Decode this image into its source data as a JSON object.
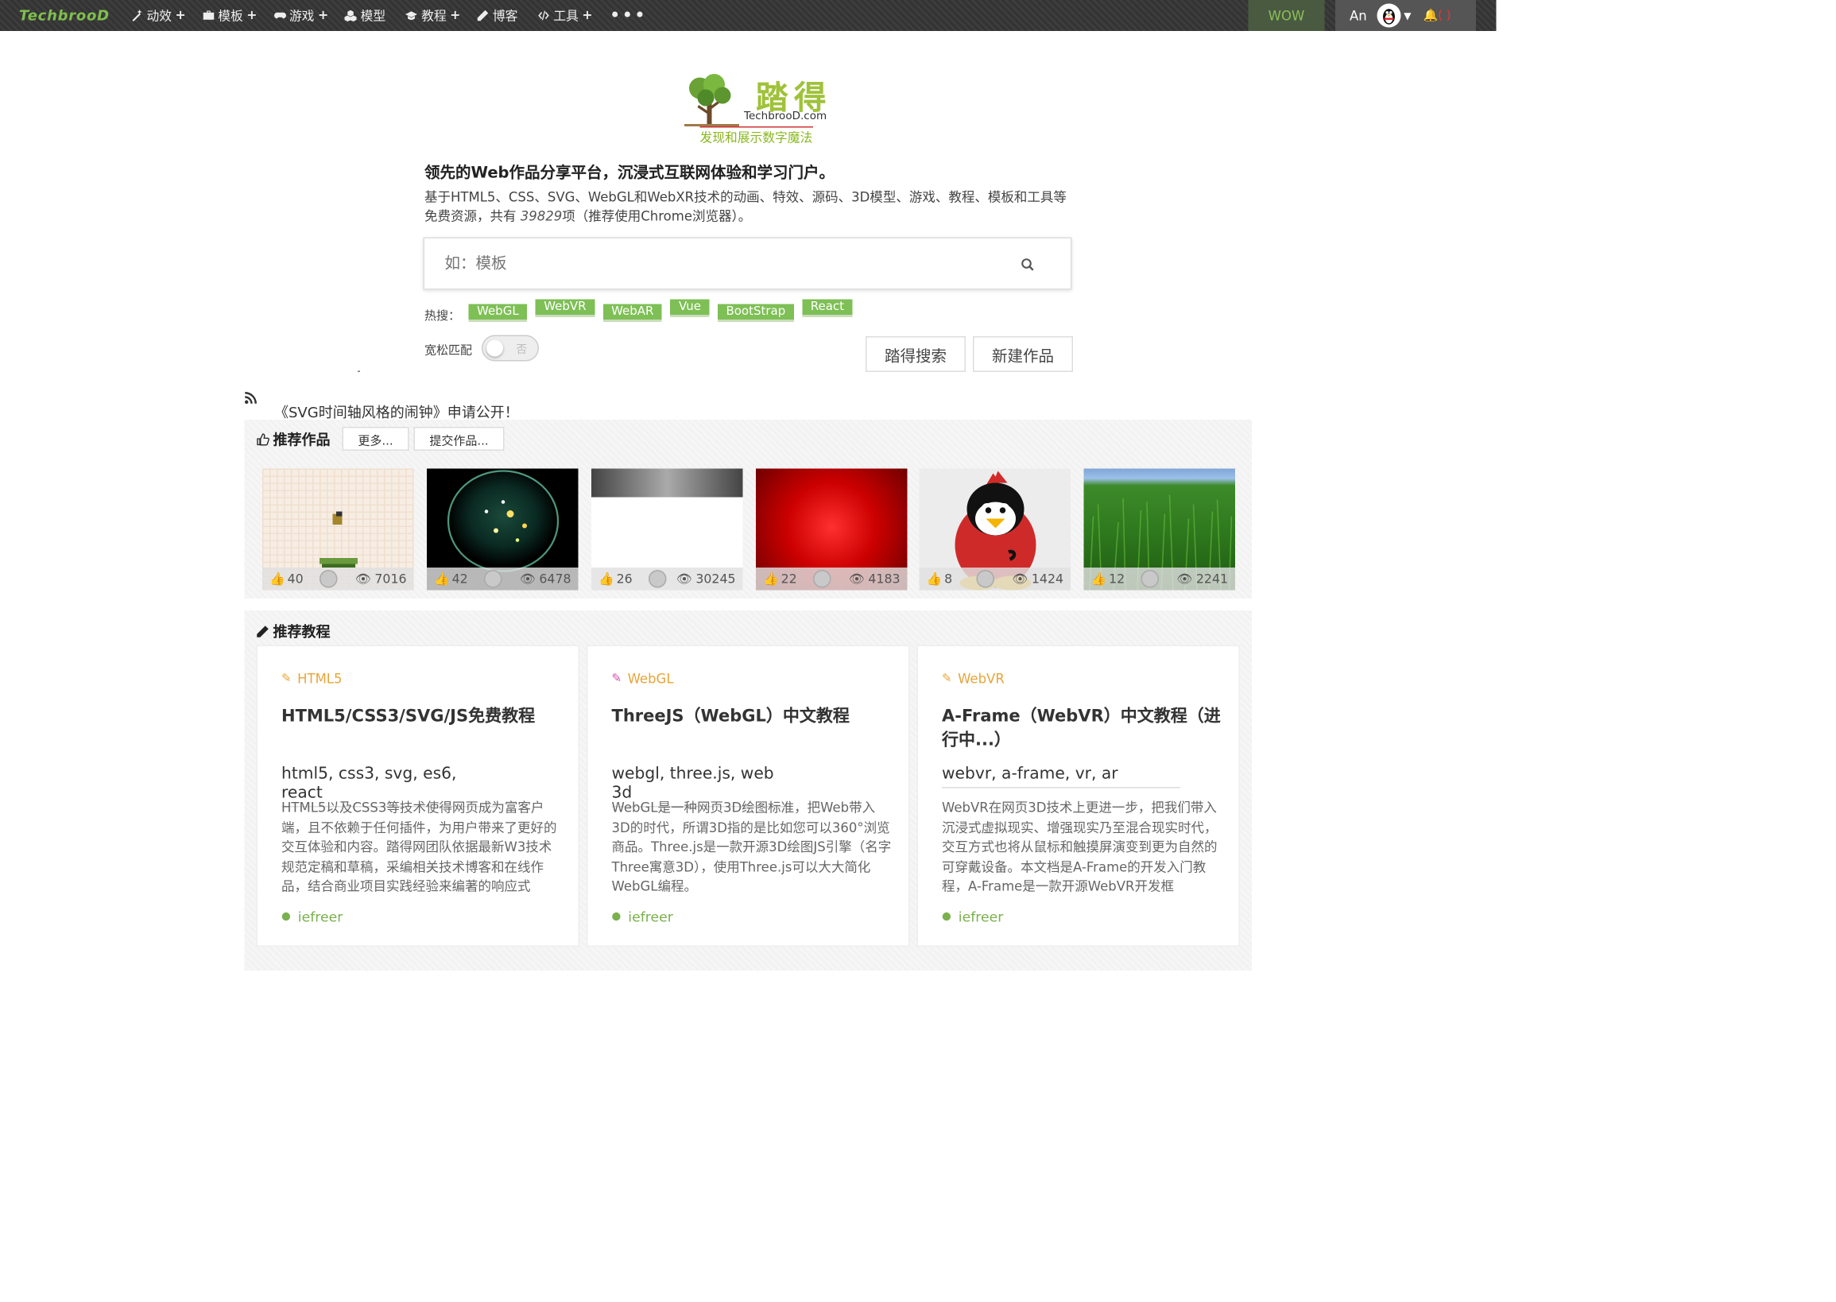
{
  "nav": {
    "logo": "TechbrooD",
    "items": [
      {
        "icon": "magic-wand-icon",
        "label": "动效",
        "plus": "+"
      },
      {
        "icon": "briefcase-icon",
        "label": "模板",
        "plus": "+"
      },
      {
        "icon": "gamepad-icon",
        "label": "游戏",
        "plus": "+"
      },
      {
        "icon": "cubes-icon",
        "label": "模型",
        "plus": ""
      },
      {
        "icon": "graduation-cap-icon",
        "label": "教程",
        "plus": "+"
      },
      {
        "icon": "pencil-icon",
        "label": "博客",
        "plus": ""
      },
      {
        "icon": "code-icon",
        "label": "工具",
        "plus": "+"
      }
    ],
    "more": "•••",
    "wow": "WOW",
    "user": "An",
    "notif_count": "( )"
  },
  "brand": {
    "cn": "踏得",
    "en": "TechbrooD.com",
    "slogan": "发现和展示数字魔法"
  },
  "headline": "领先的Web作品分享平台，沉浸式互联网体验和学习门户。",
  "desc": {
    "before": "基于HTML5、CSS、SVG、WebGL和WebXR技术的动画、特效、源码、3D模型、游戏、教程、模板和工具等免费资源，共有 ",
    "count": "39829",
    "after": "项（推荐使用Chrome浏览器）。"
  },
  "search": {
    "placeholder": "如：模板"
  },
  "hot": {
    "label": "热搜：",
    "tags": [
      "WebGL",
      "WebVR",
      "WebAR",
      "Vue",
      "BootStrap",
      "React"
    ]
  },
  "loose": {
    "label": "宽松匹配",
    "state": "否"
  },
  "buttons": {
    "search": "踏得搜索",
    "new": "新建作品"
  },
  "announcement": "《SVG时间轴风格的闹钟》申请公开！",
  "works": {
    "title": "推荐作品",
    "more": "更多...",
    "submit": "提交作品...",
    "items": [
      {
        "likes": "40",
        "views": "7016"
      },
      {
        "likes": "42",
        "views": "6478"
      },
      {
        "likes": "26",
        "views": "30245"
      },
      {
        "likes": "22",
        "views": "4183"
      },
      {
        "likes": "8",
        "views": "1424"
      },
      {
        "likes": "12",
        "views": "2241"
      }
    ]
  },
  "tutorials": {
    "title": "推荐教程",
    "cards": [
      {
        "category": "HTML5",
        "cat_color": "#e8a53a",
        "title": "HTML5/CSS3/SVG/JS免费教程",
        "keywords": "html5, css3, svg, es6, react",
        "body": "HTML5以及CSS3等技术使得网页成为富客户端，且不依赖于任何插件，为用户带来了更好的交互体验和内容。踏得网团队依据最新W3技术规范定稿和草稿，采编相关技术博客和在线作品，结合商业项目实践经验来编著的响应式",
        "author": "iefreer"
      },
      {
        "category": "WebGL",
        "cat_color": "#d44fb0",
        "title": "ThreeJS（WebGL）中文教程",
        "keywords": "webgl, three.js, web 3d",
        "body": "WebGL是一种网页3D绘图标准，把Web带入3D的时代，所谓3D指的是比如您可以360°浏览商品。Three.js是一款开源3D绘图JS引擎（名字Three寓意3D），使用Three.js可以大大简化WebGL编程。",
        "author": "iefreer"
      },
      {
        "category": "WebVR",
        "cat_color": "#e8a53a",
        "title": "A-Frame（WebVR）中文教程（进行中...）",
        "keywords": "webvr, a-frame, vr, ar",
        "body": "WebVR在网页3D技术上更进一步，把我们带入沉浸式虚拟现实、增强现实乃至混合现实时代，交互方式也将从鼠标和触摸屏演变到更为自然的可穿戴设备。本文档是A-Frame的开发入门教程，A-Frame是一款开源WebVR开发框",
        "author": "iefreer"
      }
    ]
  }
}
